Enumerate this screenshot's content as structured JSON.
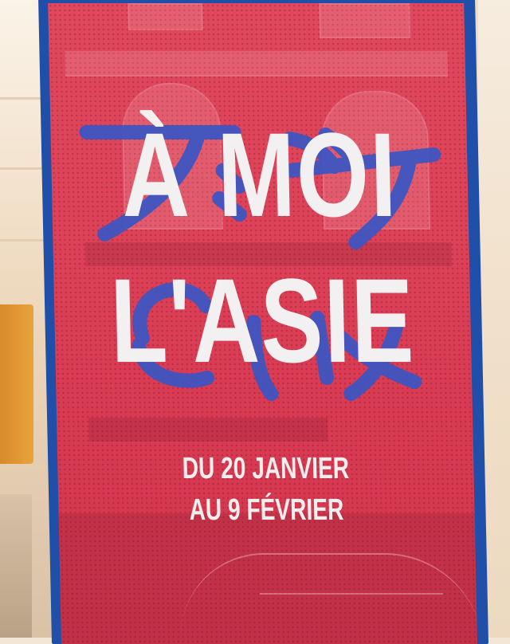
{
  "poster": {
    "title_line1": "À MOI",
    "title_line2": "L'ASIE",
    "dates_line1": "DU 20 JANVIER",
    "dates_line2": "AU 9 FÉVRIER"
  },
  "colors": {
    "banner_red": "#dd4258",
    "border_blue": "#1f4fa8",
    "calligraphy_blue": "#3a56c4",
    "text_white": "#f2f0f0",
    "wall": "#f3e6d6"
  }
}
